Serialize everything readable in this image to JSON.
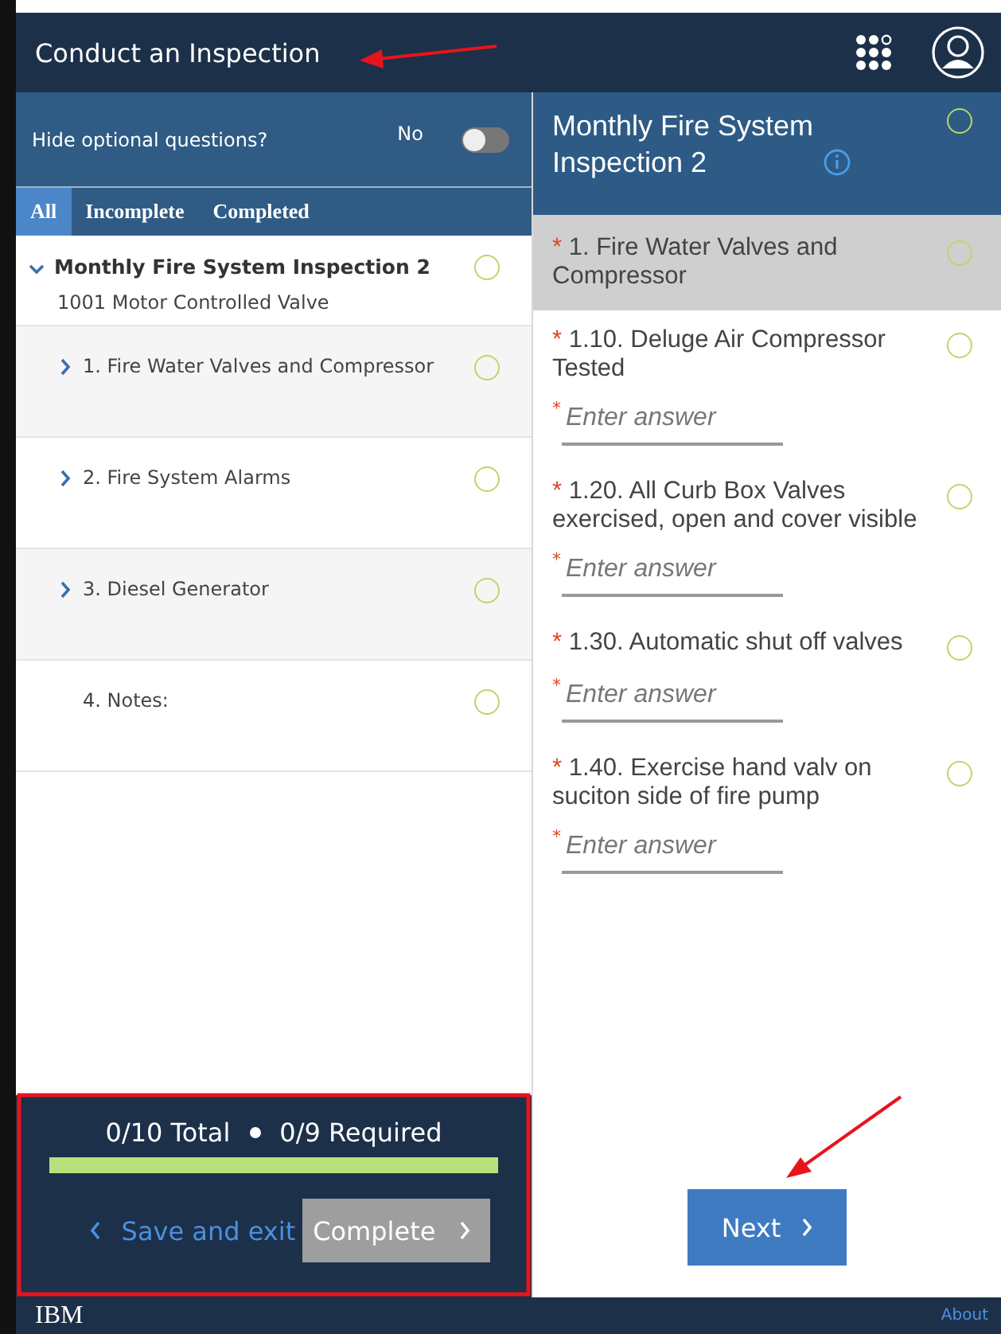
{
  "header": {
    "title": "Conduct an Inspection"
  },
  "options": {
    "label": "Hide optional questions?",
    "value": "No",
    "on": false
  },
  "tabs": [
    {
      "label": "All",
      "selected": true
    },
    {
      "label": "Incomplete",
      "selected": false
    },
    {
      "label": "Completed",
      "selected": false
    }
  ],
  "outline": [
    {
      "kind": "group",
      "title": "Monthly Fire System Inspection 2",
      "subtitle": "1001 Motor Controlled Valve",
      "expanded": true,
      "children": [
        {
          "kind": "section",
          "title": "1. Fire Water Valves and Compressor",
          "expanded": false
        },
        {
          "kind": "section",
          "title": "2. Fire System Alarms",
          "expanded": false
        },
        {
          "kind": "section",
          "title": "3. Diesel Generator",
          "expanded": false
        },
        {
          "kind": "note",
          "title": "4. Notes:"
        }
      ]
    }
  ],
  "progress": {
    "total": "0/10 Total",
    "required": "0/9 Required",
    "level": 0
  },
  "actions": {
    "back": "Save and exit",
    "complete": "Complete",
    "complete_disabled": true
  },
  "form": {
    "title": "Monthly Fire System Inspection 2",
    "items": [
      {
        "kind": "section",
        "mark": "*",
        "title": "1. Fire Water Valves and Compressor",
        "selected": true
      },
      {
        "kind": "question",
        "mark": "*",
        "title": "1.10. Deluge Air Compressor Tested",
        "answer_mark": "*",
        "placeholder": "Enter answer",
        "selected": false
      },
      {
        "kind": "question",
        "mark": "*",
        "title": "1.20. All Curb Box Valves exercised, open and cover visible",
        "answer_mark": "*",
        "placeholder": "Enter answer",
        "selected": false
      },
      {
        "kind": "question",
        "mark": "*",
        "title": "1.30. Automatic shut off valves",
        "answer_mark": "*",
        "placeholder": "Enter answer",
        "selected": false
      },
      {
        "kind": "question",
        "mark": "*",
        "title": "1.40. Exercise hand valv on suciton side of fire pump",
        "answer_mark": "*",
        "placeholder": "Enter answer",
        "selected": false
      }
    ],
    "next": "Next"
  },
  "footer": {
    "brand": "IBM",
    "link": "About"
  }
}
